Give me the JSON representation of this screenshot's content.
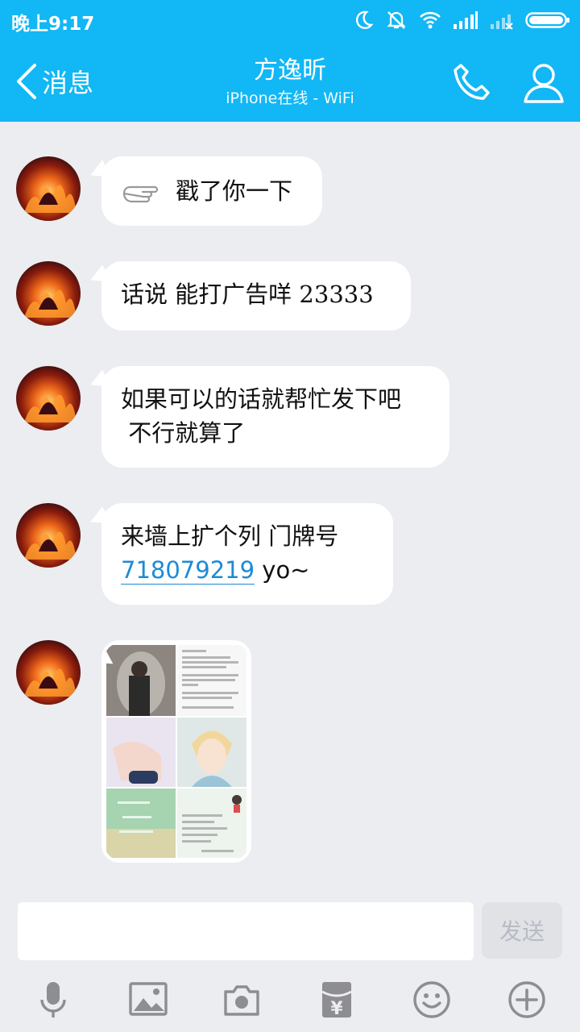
{
  "status_bar": {
    "time": "晚上9:17"
  },
  "header": {
    "back_label": "消息",
    "title": "方逸昕",
    "subtitle": "iPhone在线 - WiFi"
  },
  "messages": [
    {
      "text": "戳了你一下"
    },
    {
      "text": "话说 能打广告咩 23333"
    },
    {
      "line1": "如果可以的话就帮忙发下吧",
      "line2": " 不行就算了"
    },
    {
      "line1": "来墙上扩个列 门牌号",
      "link": "718079219",
      "tail": " yo~"
    }
  ],
  "input": {
    "placeholder": "",
    "send_label": "发送"
  },
  "toolbar": {
    "icons": [
      "microphone-icon",
      "image-icon",
      "camera-icon",
      "red-packet-icon",
      "emoji-icon",
      "plus-icon"
    ]
  },
  "colors": {
    "header": "#12b7f5",
    "background": "#ebedf0",
    "link": "#1c8bd6",
    "send_disabled": "#e0e2e6"
  }
}
